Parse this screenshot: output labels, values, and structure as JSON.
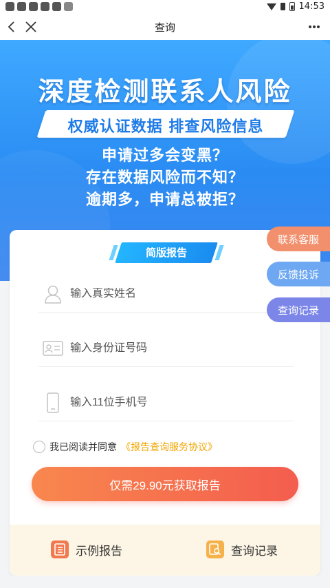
{
  "status_bar": {
    "time": "14:53"
  },
  "nav": {
    "title": "查询"
  },
  "hero": {
    "title": "深度检测联系人风险",
    "banner": "权威认证数据  排查风险信息",
    "questions": [
      "申请过多会变黑？",
      "存在数据风险而不知？",
      "逾期多，申请总被拒？"
    ]
  },
  "card": {
    "tag": "简版报告",
    "fields": {
      "name_placeholder": "输入真实姓名",
      "id_placeholder": "输入身份证号码",
      "phone_placeholder": "输入11位手机号"
    },
    "agree_text": "我已阅读并同意",
    "agree_link": "《报告查询服务协议》",
    "submit_label": "仅需29.90元获取报告",
    "bottom": {
      "sample_label": "示例报告",
      "records_label": "查询记录"
    }
  },
  "side_tabs": [
    "联系客服",
    "反馈投诉",
    "查询记录"
  ],
  "colors": {
    "hero_blue": "#2a8cf3",
    "primary_button": "#f45d4e",
    "link": "#f2a500",
    "tab_contact": "#f28f6c",
    "tab_feedback": "#6ea8f2",
    "tab_records": "#7b86e8"
  }
}
